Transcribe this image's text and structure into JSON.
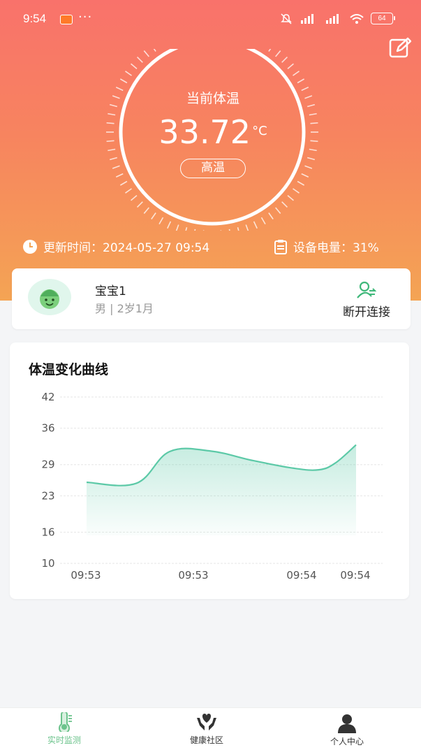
{
  "status_bar": {
    "time": "9:54",
    "dots": "···",
    "battery": "64"
  },
  "gauge": {
    "label": "当前体温",
    "value": "33.72",
    "unit": "°C",
    "status": "高温"
  },
  "info": {
    "update_label": "更新时间：2024-05-27 09:54",
    "battery_label": "设备电量：31%"
  },
  "profile": {
    "name": "宝宝1",
    "details": "男 | 2岁1月",
    "disconnect_label": "断开连接"
  },
  "chart_data": {
    "type": "area",
    "title": "体温变化曲线",
    "x_ticks": [
      "09:53",
      "09:53",
      "09:54",
      "09:54"
    ],
    "y_ticks": [
      42,
      36,
      29,
      23,
      16,
      10
    ],
    "ylim": [
      10,
      42
    ],
    "grid": true,
    "points": [
      {
        "x": 0,
        "y": 25.6
      },
      {
        "x": 0.6,
        "y": 25.4
      },
      {
        "x": 1.0,
        "y": 31.5
      },
      {
        "x": 1.5,
        "y": 31.6
      },
      {
        "x": 2.0,
        "y": 29.8
      },
      {
        "x": 2.5,
        "y": 28.3
      },
      {
        "x": 2.8,
        "y": 28.0
      },
      {
        "x": 3.0,
        "y": 29.3
      },
      {
        "x": 3.25,
        "y": 32.8
      }
    ],
    "color": "#5cc9a7"
  },
  "tabs": [
    {
      "label": "实时监测",
      "icon": "thermometer-icon",
      "active": true
    },
    {
      "label": "健康社区",
      "icon": "heart-hands-icon",
      "active": false
    },
    {
      "label": "个人中心",
      "icon": "person-icon",
      "active": false
    }
  ],
  "colors": {
    "hero_top": "#f9726b",
    "hero_bottom": "#f4a454",
    "accent_green": "#6cc38c"
  }
}
